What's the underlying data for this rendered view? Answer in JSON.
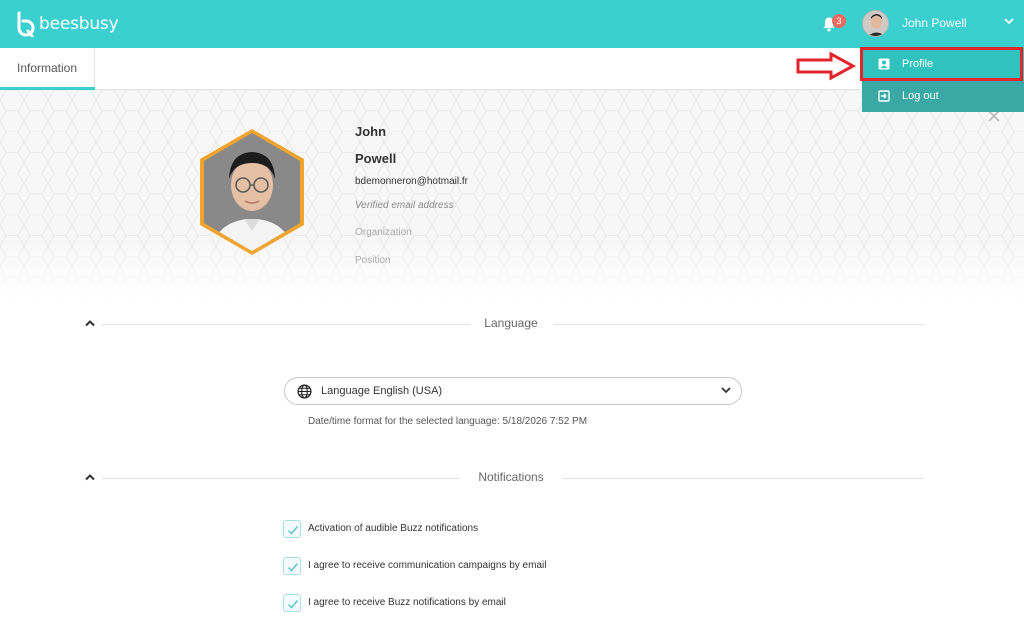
{
  "app": {
    "logo_text": "beesbusy"
  },
  "topbar": {
    "notification_count": "3",
    "user_name": "John Powell"
  },
  "tabs": [
    {
      "label": "Information",
      "active": true
    }
  ],
  "user_menu": {
    "items": [
      {
        "label": "Profile",
        "icon": "person-badge-icon",
        "highlighted": true
      },
      {
        "label": "Log out",
        "icon": "logout-icon"
      }
    ]
  },
  "profile": {
    "first_name": "John",
    "last_name": "Powell",
    "email": "bdemonneron@hotmail.fr",
    "email_status": "Verified email address",
    "organization_placeholder": "Organization",
    "position_placeholder": "Position"
  },
  "language_section": {
    "title": "Language",
    "select_label": "Language English (USA)",
    "date_format_text": "Date/time format for the selected language: 5/18/2026 7:52 PM"
  },
  "notifications_section": {
    "title": "Notifications",
    "options": [
      {
        "label": "Activation of audible Buzz notifications",
        "checked": true
      },
      {
        "label": "I agree to receive communication campaigns by email",
        "checked": true
      },
      {
        "label": "I agree to receive Buzz notifications by email",
        "checked": true
      }
    ]
  },
  "colors": {
    "brand": "#3ccfcf",
    "menu": "#3ab8b4",
    "highlight": "#e2242c",
    "avatar_border": "#f0a530",
    "badge": "#ef6b5f"
  }
}
